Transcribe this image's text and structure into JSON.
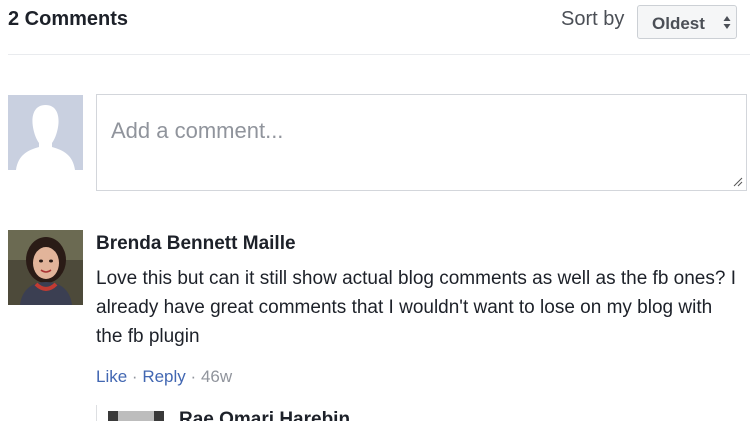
{
  "header": {
    "comment_count": "2 Comments",
    "sort_label": "Sort by",
    "sort_value": "Oldest"
  },
  "composer": {
    "placeholder": "Add a comment..."
  },
  "comments": [
    {
      "author": "Brenda Bennett Maille",
      "text": "Love this but can it still show actual blog comments as well as the fb ones? I already have great comments that I wouldn't want to lose on my blog with the fb plugin",
      "like_label": "Like",
      "reply_label": "Reply",
      "age": "46w",
      "separator": "·"
    }
  ],
  "reply_preview": {
    "author": "Rae Omari Harebin"
  },
  "colors": {
    "link": "#4267b2",
    "muted": "#90949c",
    "text": "#1d2129",
    "border": "#ccd0d5"
  }
}
